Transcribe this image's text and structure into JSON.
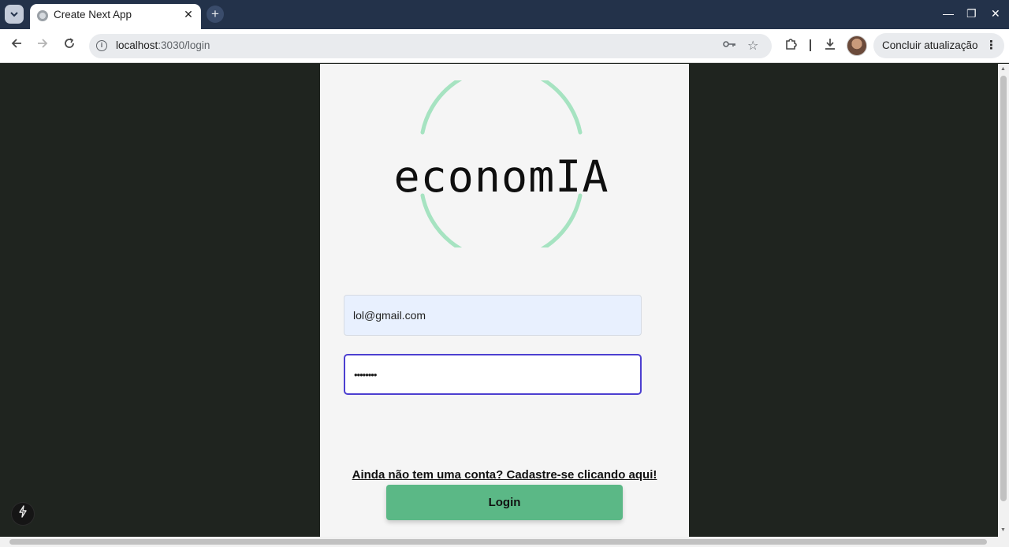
{
  "browser": {
    "tab_title": "Create Next App",
    "tab_close": "✕",
    "new_tab": "+",
    "url_host": "localhost",
    "url_path": ":3030/login",
    "update_label": "Concluir atualização",
    "window_controls": {
      "minimize": "—",
      "maximize": "❐",
      "close": "✕"
    }
  },
  "page": {
    "logo_text": "economIA",
    "logo_ring_color": "#a6e3c1",
    "email_value": "lol@gmail.com",
    "password_value": "••••••••",
    "signup_text": "Ainda não tem uma conta? Cadastre-se clicando aqui!",
    "login_label": "Login",
    "accent_color": "#5bb886",
    "focus_color": "#4c3fd0"
  },
  "icons": {
    "tab_list": "chevron-down-icon",
    "back": "arrow-left-icon",
    "forward": "arrow-right-icon",
    "reload": "reload-icon",
    "site_info": "info-icon",
    "password_key": "key-icon",
    "bookmark": "star-icon",
    "extensions": "puzzle-icon",
    "downloads": "download-icon",
    "menu": "kebab-menu-icon",
    "next_indicator": "lightning-icon"
  }
}
